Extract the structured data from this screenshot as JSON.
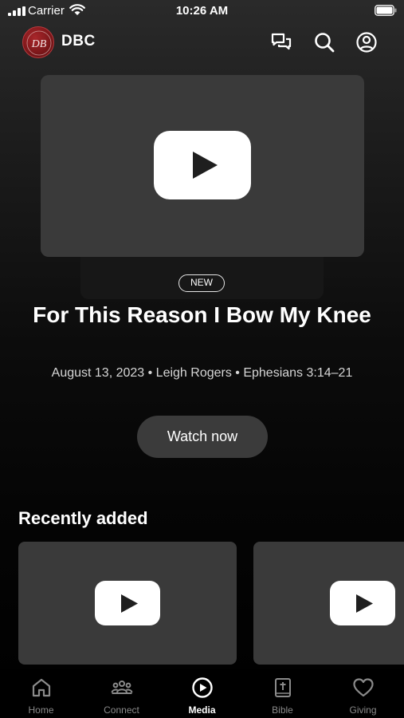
{
  "status_bar": {
    "carrier": "Carrier",
    "time": "10:26 AM"
  },
  "header": {
    "logo_text": "DB",
    "church_name": "DBC",
    "icons": [
      "chat-icon",
      "search-icon",
      "account-icon"
    ]
  },
  "hero": {
    "badge": "NEW",
    "title": "For This Reason I Bow My Knee",
    "meta": "August 13, 2023 • Leigh Rogers • Ephesians 3:14–21",
    "cta_label": "Watch now"
  },
  "recently_added": {
    "heading": "Recently added",
    "cards": [
      {
        "icon": "play-icon"
      },
      {
        "icon": "play-icon"
      }
    ]
  },
  "tab_bar": {
    "active": "Media",
    "tabs": [
      {
        "label": "Home",
        "icon": "home-icon"
      },
      {
        "label": "Connect",
        "icon": "people-icon"
      },
      {
        "label": "Media",
        "icon": "play-circle-icon"
      },
      {
        "label": "Bible",
        "icon": "bible-icon"
      },
      {
        "label": "Giving",
        "icon": "heart-icon"
      }
    ]
  },
  "colors": {
    "background": "#000000",
    "card": "#3a3a3a",
    "button": "#3b3b3b",
    "logo": "#7a1619",
    "inactive_tab": "#8a8a8a"
  }
}
